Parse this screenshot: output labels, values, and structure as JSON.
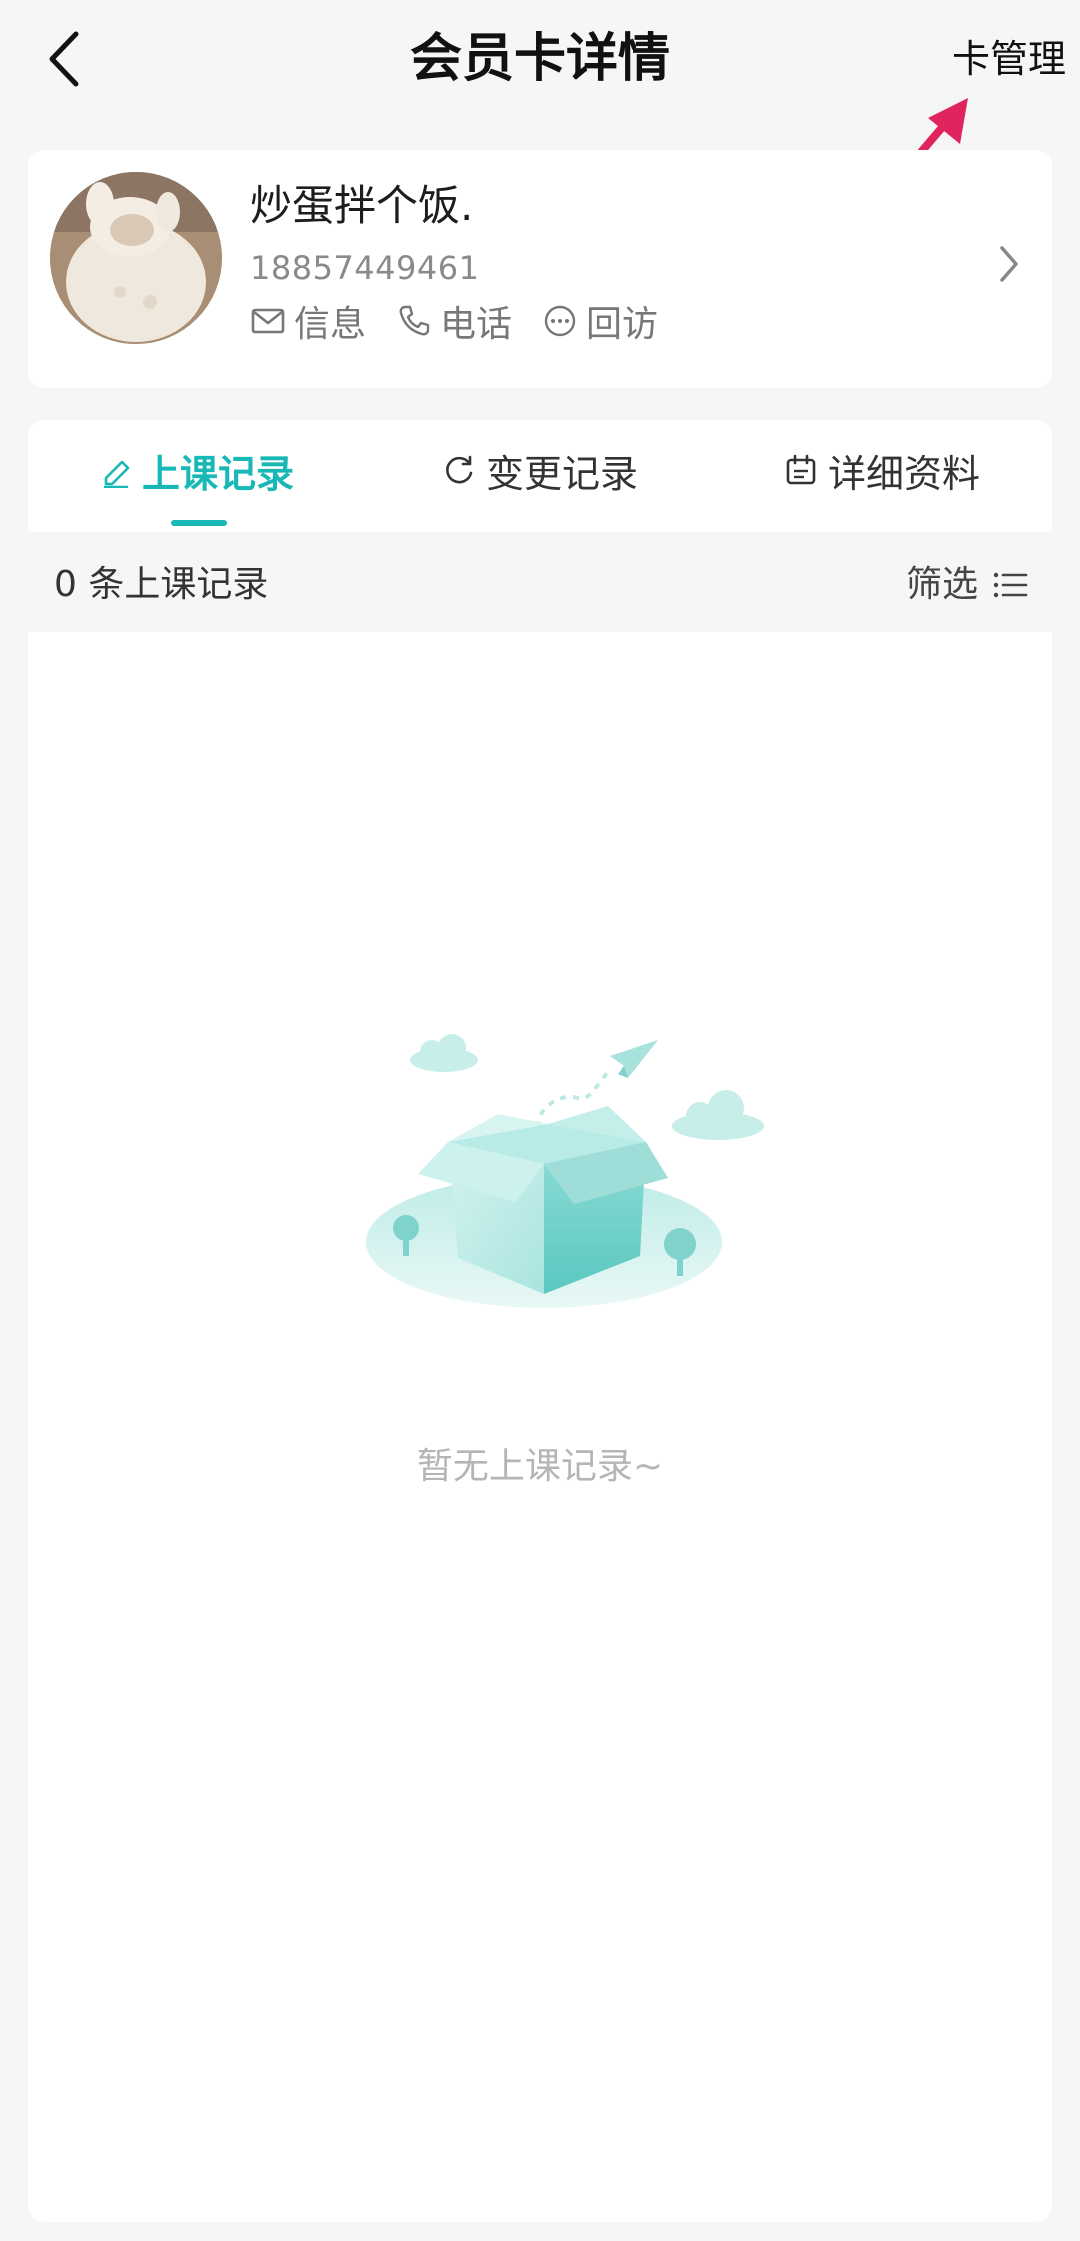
{
  "header": {
    "title": "会员卡详情",
    "manage_label": "卡管理"
  },
  "profile": {
    "name": "炒蛋拌个饭.",
    "phone": "18857449461",
    "actions": [
      {
        "icon": "mail-icon",
        "label": "信息"
      },
      {
        "icon": "phone-icon",
        "label": "电话"
      },
      {
        "icon": "chat-icon",
        "label": "回访"
      }
    ]
  },
  "tabs": [
    {
      "icon": "pencil-icon",
      "label": "上课记录",
      "active": true
    },
    {
      "icon": "refresh-icon",
      "label": "变更记录",
      "active": false
    },
    {
      "icon": "calendar-icon",
      "label": "详细资料",
      "active": false
    }
  ],
  "records": {
    "count_text": "0 条上课记录",
    "filter_label": "筛选",
    "empty_text": "暂无上课记录~"
  },
  "colors": {
    "accent": "#17b8b6",
    "annotation_arrow": "#e0245e"
  }
}
